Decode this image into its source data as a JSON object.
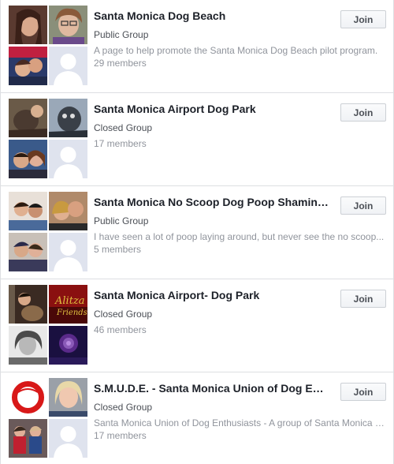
{
  "join_label": "Join",
  "groups": [
    {
      "name": "Santa Monica Dog Beach",
      "type": "Public Group",
      "description": "A page to help promote the Santa Monica Dog Beach pilot program.",
      "members": "29 members"
    },
    {
      "name": "Santa Monica Airport Dog Park",
      "type": "Closed Group",
      "description": "",
      "members": "17 members"
    },
    {
      "name": "Santa Monica No Scoop Dog Poop Shaming Group",
      "type": "Public Group",
      "description": "I have seen a lot of poop laying around, but never see the no scoop...",
      "members": "5 members"
    },
    {
      "name": "Santa Monica Airport- Dog Park",
      "type": "Closed Group",
      "description": "",
      "members": "46 members"
    },
    {
      "name": "S.M.U.D.E. - Santa Monica Union of Dog Enthusiasts",
      "type": "Closed Group",
      "description": "Santa Monica Union of Dog Enthusiasts - A group of Santa Monica dog lovers",
      "members": "17 members"
    }
  ],
  "colors": {
    "silhouette_bg": "#dfe3ee",
    "silhouette_fg": "#ffffff",
    "link": "#1d2129",
    "meta": "#90949c"
  }
}
